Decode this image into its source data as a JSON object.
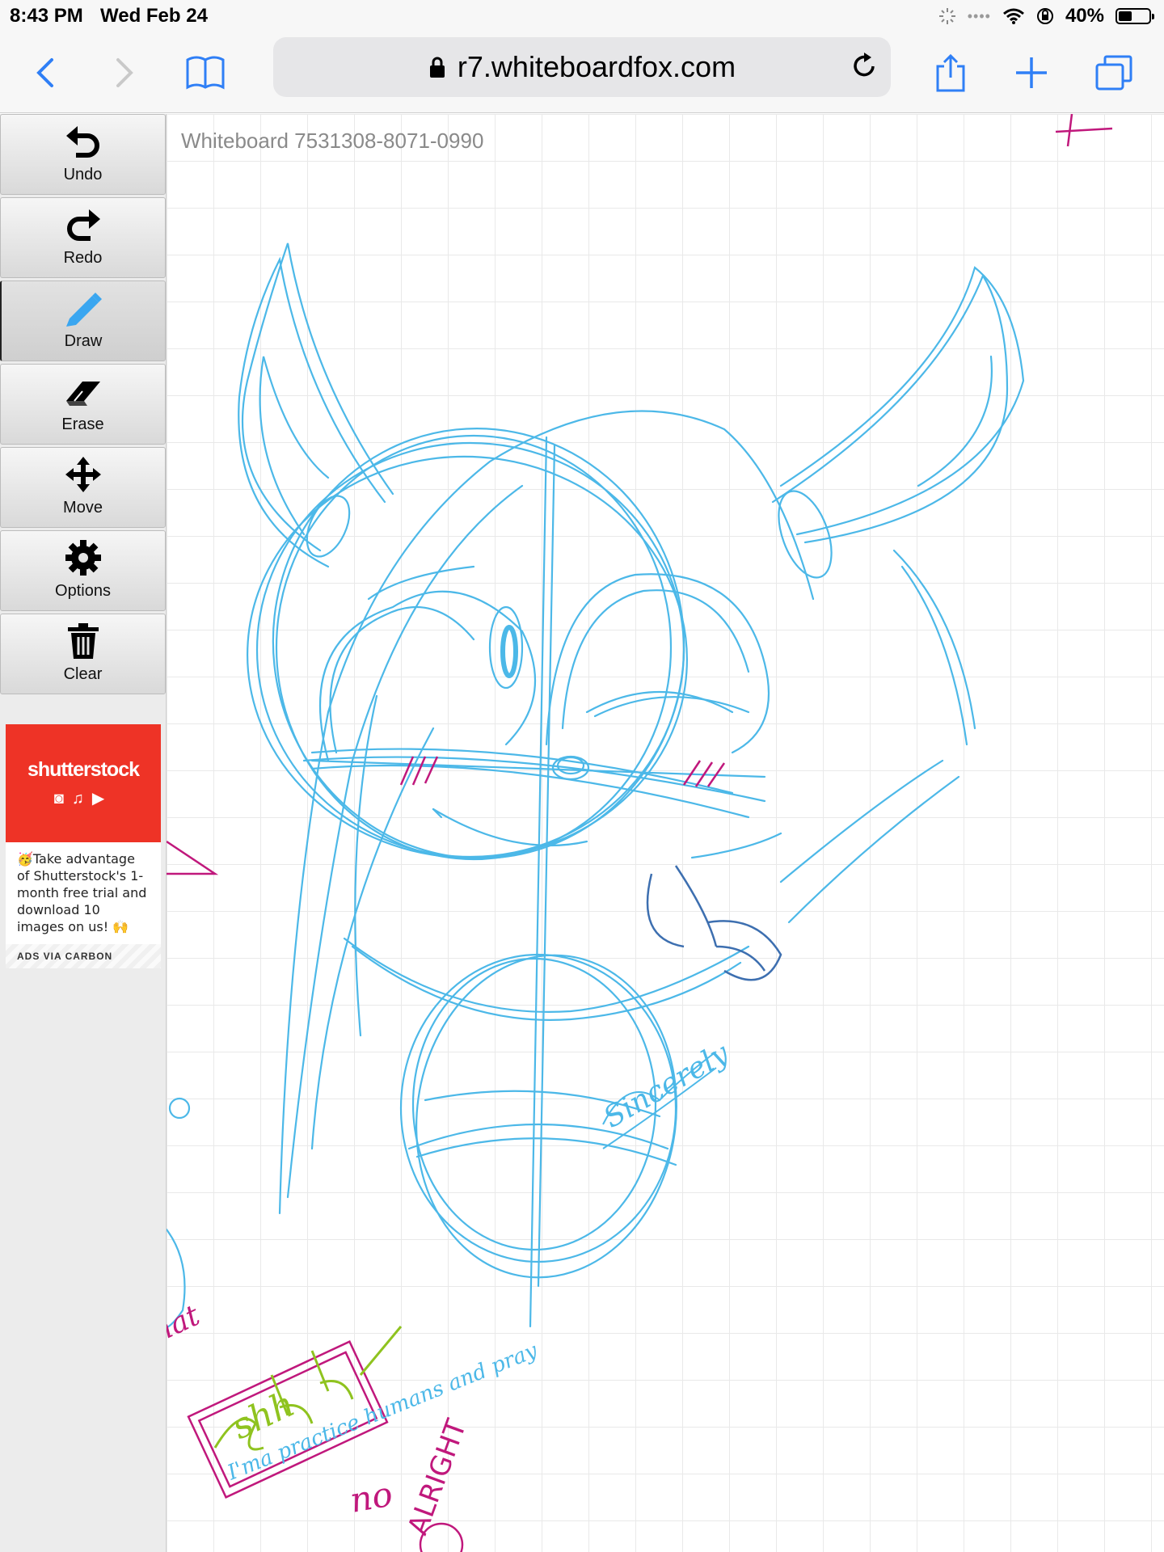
{
  "status": {
    "time": "8:43 PM",
    "date": "Wed Feb 24",
    "battery": "40%",
    "battery_level": 0.4
  },
  "browser": {
    "url": "r7.whiteboardfox.com"
  },
  "toolbar": {
    "items": [
      {
        "label": "Undo",
        "icon": "undo-icon"
      },
      {
        "label": "Redo",
        "icon": "redo-icon"
      },
      {
        "label": "Draw",
        "icon": "pencil-icon"
      },
      {
        "label": "Erase",
        "icon": "eraser-icon"
      },
      {
        "label": "Move",
        "icon": "move-icon"
      },
      {
        "label": "Options",
        "icon": "gear-icon"
      },
      {
        "label": "Clear",
        "icon": "trash-icon"
      }
    ],
    "active": "Draw"
  },
  "ad": {
    "brand": "shutterstock",
    "message": "🥳Take advantage of Shutterstock's 1-month free trial and download 10 images on us! 🙌",
    "footer": "ADS VIA CARBON",
    "brand_color": "#ee3326"
  },
  "board": {
    "title": "Whiteboard 7531308-8071-0990",
    "stroke_color": "#4cb8e8",
    "accent_color": "#c0187c",
    "handwriting": {
      "shh": "shh",
      "no": "no",
      "hat": "hat",
      "sincerely": "Sincerely",
      "practice": "I'ma practice humans and pray",
      "alright": "ALRIGHT"
    }
  }
}
